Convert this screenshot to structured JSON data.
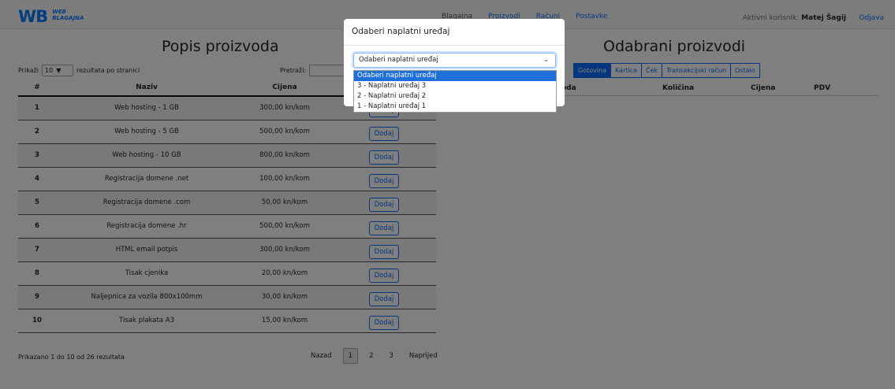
{
  "nav": {
    "logo_mark": "WB",
    "logo_line1": "WEB",
    "logo_line2": "BLAGAJNA",
    "links": [
      "Blagajna",
      "Proizvodi",
      "Računi",
      "Postavke"
    ],
    "user_label": "Aktivni korisnik:",
    "user_name": "Matej Šagij",
    "logout": "Odjava"
  },
  "left": {
    "title": "Popis proizvoda",
    "show_prefix": "Prikaži",
    "show_value": "10",
    "show_suffix": "rezultata po stranici",
    "search_label": "Pretraži:",
    "columns": [
      "#",
      "Naziv",
      "Cijena",
      ""
    ],
    "rows": [
      {
        "num": "1",
        "name": "Web hosting - 1 GB",
        "price": "300,00 kn/kom"
      },
      {
        "num": "2",
        "name": "Web hosting - 5 GB",
        "price": "500,00 kn/kom"
      },
      {
        "num": "3",
        "name": "Web hosting - 10 GB",
        "price": "800,00 kn/kom"
      },
      {
        "num": "4",
        "name": "Registracija domene .net",
        "price": "100,00 kn/kom"
      },
      {
        "num": "5",
        "name": "Registracija domene .com",
        "price": "50,00 kn/kom"
      },
      {
        "num": "6",
        "name": "Registracija domene .hr",
        "price": "500,00 kn/kom"
      },
      {
        "num": "7",
        "name": "HTML email potpis",
        "price": "300,00 kn/kom"
      },
      {
        "num": "8",
        "name": "Tisak cjenika",
        "price": "20,00 kn/kom"
      },
      {
        "num": "9",
        "name": "Naljepnica za vozila 800x100mm",
        "price": "30,00 kn/kom"
      },
      {
        "num": "10",
        "name": "Tisak plakata A3",
        "price": "15,00 kn/kom"
      }
    ],
    "add_label": "Dodaj",
    "footer_info": "Prikazano 1 do 10 od 26 rezultata",
    "pager": {
      "prev": "Nazad",
      "pages": [
        "1",
        "2",
        "3"
      ],
      "next": "Naprijed"
    }
  },
  "right": {
    "title": "Odabrani proizvodi",
    "payment_methods": [
      "Gotovina",
      "Kartica",
      "Ček",
      "Transakcijski račun",
      "Ostalo"
    ],
    "columns": [
      "oda",
      "Količina",
      "Cijena",
      "PDV"
    ]
  },
  "modal": {
    "title": "Odaberi naplatni uređaj",
    "select_value": "Odaberi naplatni uređaj",
    "options": [
      "Odaberi naplatni uređaj",
      "3 - Naplatni uređaj 3",
      "2 - Naplatni uređaj 2",
      "1 - Naplatni uređaj 1"
    ]
  }
}
